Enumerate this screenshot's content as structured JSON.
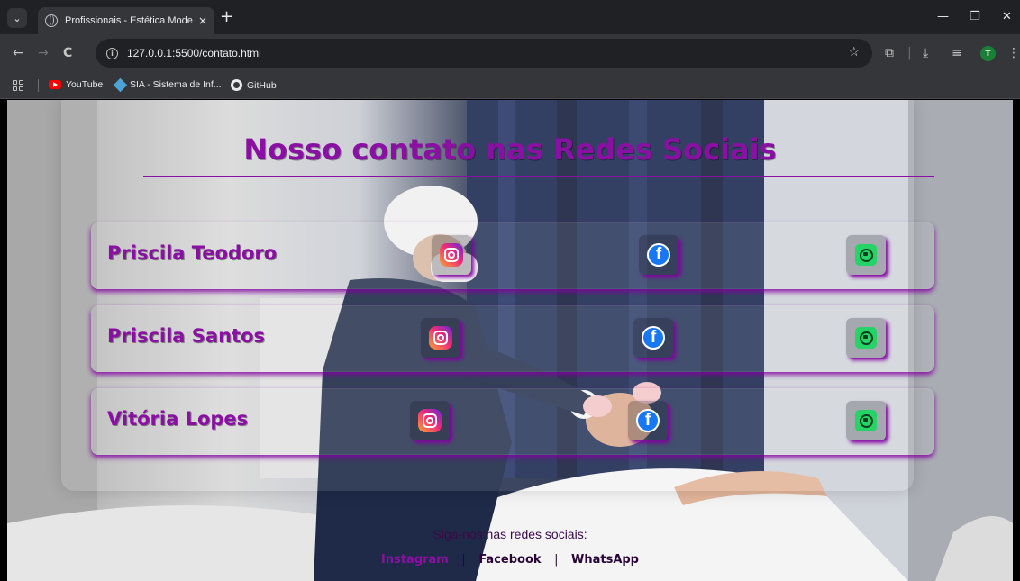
{
  "browser": {
    "tab_title": "Profissionais - Estética Moderna",
    "tab_close": "×",
    "new_tab": "+",
    "url": "127.0.0.1:5500/contato.html",
    "window_minimize": "—",
    "window_restore": "❐",
    "window_close": "✕",
    "back": "←",
    "forward": "→",
    "reload": "C",
    "profile_initial": "T",
    "bookmarks": [
      {
        "label": "YouTube",
        "icon": "youtube-icon"
      },
      {
        "label": "SIA - Sistema de Inf...",
        "icon": "sia-icon"
      },
      {
        "label": "GitHub",
        "icon": "github-icon"
      }
    ]
  },
  "page": {
    "title": "Nosso contato nas Redes Sociais",
    "contacts": [
      {
        "name": "Priscila Teodoro"
      },
      {
        "name": "Priscila Santos"
      },
      {
        "name": "Vitória Lopes"
      }
    ],
    "social_icons": [
      "instagram-icon",
      "facebook-icon",
      "whatsapp-icon"
    ],
    "fb_letter": "f",
    "footer": {
      "text": "Siga-nos nas redes sociais:",
      "links": [
        "Instagram",
        "Facebook",
        "WhatsApp"
      ],
      "separator": "|"
    }
  },
  "colors": {
    "brand_purple": "#8a0fa3",
    "chrome_dark": "#202124",
    "chrome_mid": "#35363a"
  }
}
